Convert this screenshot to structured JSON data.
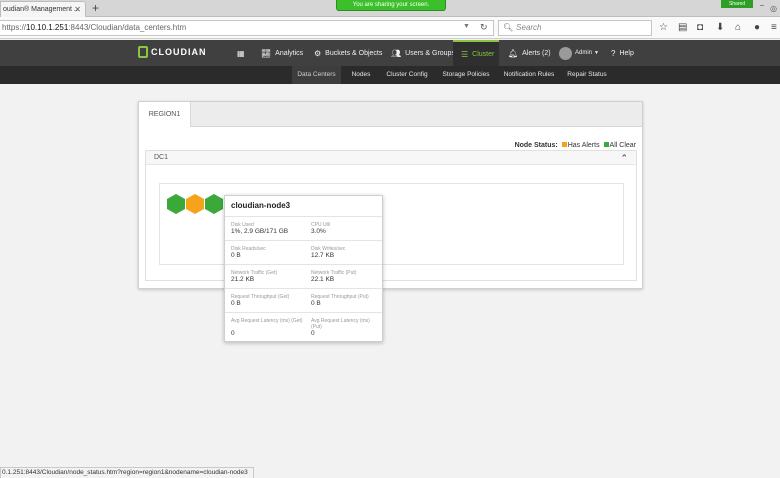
{
  "browser": {
    "tab_title": "oudian® Management ...",
    "tab_close": "✕",
    "new_tab": "+",
    "share_banner": "You are sharing your screen.",
    "corner_badge": "Shared",
    "url_scheme": "https://",
    "url_host": "10.10.1.251",
    "url_rest": ":8443/Cloudian/data_centers.htm",
    "search_placeholder": "Search",
    "status_url": "0.1.251:8443/Cloudian/node_status.htm?region=region1&nodename=cloudian-node3"
  },
  "app": {
    "logo_text": "CLOUDIAN",
    "nav": {
      "analytics": "Analytics",
      "buckets": "Buckets & Objects",
      "users": "Users & Groups",
      "cluster": "Cluster",
      "alerts": "Alerts (2)",
      "admin": "Admin",
      "help": "Help"
    },
    "subnav": {
      "data_centers": "Data Centers",
      "nodes": "Nodes",
      "cluster_config": "Cluster Config",
      "storage_policies": "Storage Policies",
      "notification_rules": "Notification Rules",
      "repair_status": "Repair Status"
    }
  },
  "main": {
    "region_tab": "REGION1",
    "node_status_label": "Node Status:",
    "legend_alerts": "Has Alerts",
    "legend_clear": "All Clear",
    "dc_label": "DC1",
    "colors": {
      "alert": "#f5a31a",
      "clear": "#3aa93a",
      "accent": "#8cc63f"
    }
  },
  "popup": {
    "title": "cloudian-node3",
    "disk_used_label": "Disk Used",
    "disk_used_value": "1%, 2.9 GB/171 GB",
    "cpu_label": "CPU Util",
    "cpu_value": "3.0%",
    "disk_reads_label": "Disk Reads/sec",
    "disk_reads_value": "0 B",
    "disk_writes_label": "Disk Writes/sec",
    "disk_writes_value": "12.7 KB",
    "net_get_label": "Network Traffic (Get)",
    "net_get_value": "21.2 KB",
    "net_put_label": "Network Traffic (Put)",
    "net_put_value": "22.1 KB",
    "thr_get_label": "Request Throughput (Get)",
    "thr_get_value": "0 B",
    "thr_put_label": "Request Throughput (Put)",
    "thr_put_value": "0 B",
    "lat_get_label": "Avg Request Latency (ms) (Get)",
    "lat_get_value": "0",
    "lat_put_label": "Avg Request Latency (ms) (Put)",
    "lat_put_value": "0"
  }
}
